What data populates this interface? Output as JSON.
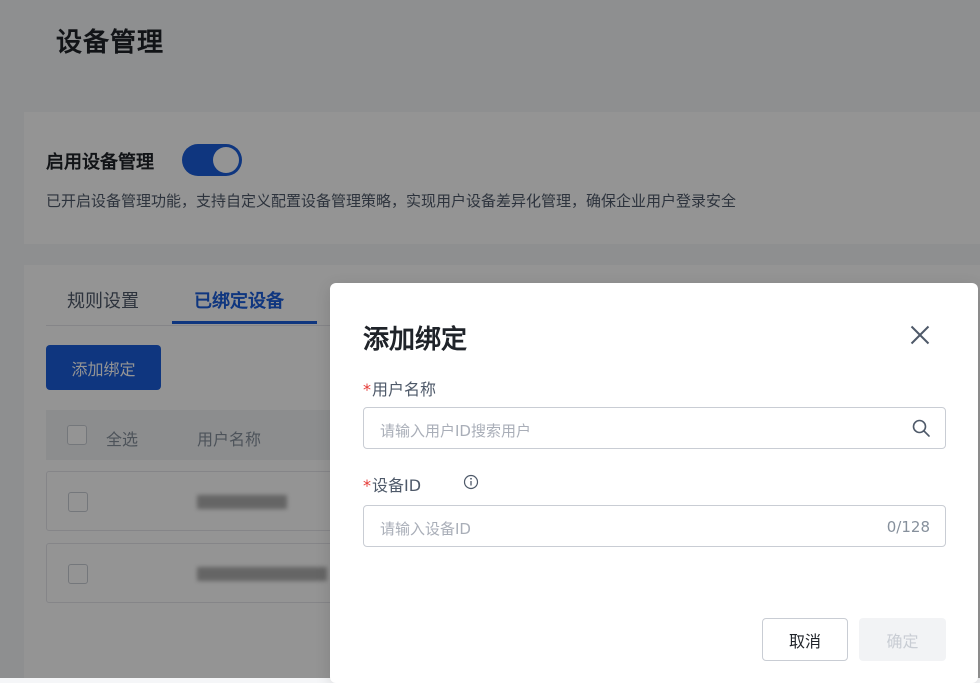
{
  "page": {
    "title": "设备管理"
  },
  "settings": {
    "toggle_label": "启用设备管理",
    "toggle_on": true,
    "description": "已开启设备管理功能，支持自定义配置设备管理策略，实现用户设备差异化管理，确保企业用户登录安全"
  },
  "tabs": [
    {
      "label": "规则设置",
      "active": false
    },
    {
      "label": "已绑定设备",
      "active": true
    }
  ],
  "toolbar": {
    "add_label": "添加绑定"
  },
  "table": {
    "headers": {
      "select_all": "全选",
      "username": "用户名称"
    }
  },
  "modal": {
    "title": "添加绑定",
    "username": {
      "label": "用户名称",
      "placeholder": "请输入用户ID搜索用户"
    },
    "device_id": {
      "label": "设备ID",
      "placeholder": "请输入设备ID",
      "counter": "0/128"
    },
    "cancel_label": "取消",
    "ok_label": "确定"
  },
  "colors": {
    "accent": "#1a5ddb",
    "required": "#e53935"
  }
}
